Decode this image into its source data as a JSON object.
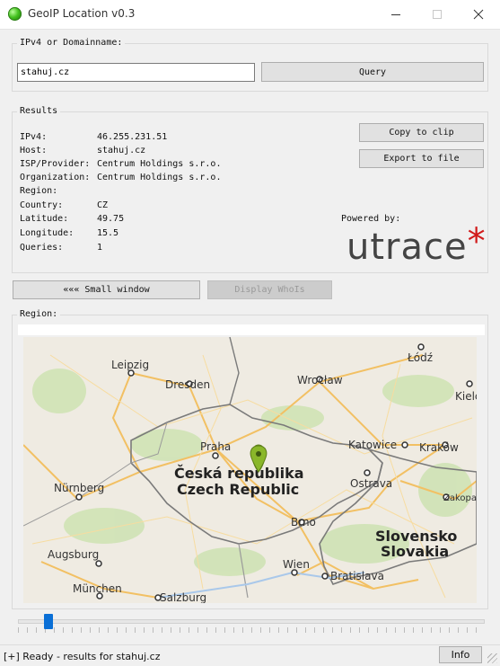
{
  "window": {
    "title": "GeoIP Location v0.3"
  },
  "input_group": {
    "legend": "IPv4 or Domainname:",
    "input_value": "stahuj.cz",
    "query_label": "Query"
  },
  "results": {
    "legend": "Results",
    "rows": [
      {
        "label": "IPv4:",
        "value": "46.255.231.51"
      },
      {
        "label": "Host:",
        "value": "stahuj.cz"
      },
      {
        "label": "ISP/Provider:",
        "value": "Centrum Holdings s.r.o."
      },
      {
        "label": "Organization:",
        "value": "Centrum Holdings s.r.o."
      },
      {
        "label": "Region:",
        "value": ""
      },
      {
        "label": "Country:",
        "value": "CZ"
      },
      {
        "label": "Latitude:",
        "value": "49.75"
      },
      {
        "label": "Longitude:",
        "value": "15.5"
      },
      {
        "label": "Queries:",
        "value": "1"
      }
    ],
    "copy_label": "Copy to clip",
    "export_label": "Export to file",
    "powered_by": "Powered by:",
    "logo_text": "utrace",
    "logo_star": "*"
  },
  "actions": {
    "small_window_label": "««« Small window",
    "whois_label": "Display WhoIs"
  },
  "region": {
    "legend": "Region:",
    "cities": {
      "leipzig": "Leipzig",
      "dresden": "Dresden",
      "wroclaw": "Wrocław",
      "lodz": "Łódź",
      "kielce": "Kielce",
      "praha": "Praha",
      "katowice": "Katowice",
      "krakow": "Kraków",
      "ostrava": "Ostrava",
      "nurnberg": "Nürnberg",
      "zakopane": "Zakopane",
      "brno": "Brno",
      "augsburg": "Augsburg",
      "wien": "Wien",
      "bratislava": "Bratislava",
      "munchen": "München",
      "salzburg": "Salzburg"
    },
    "countries": {
      "cz_local": "Česká republika",
      "cz_en": "Czech Republic",
      "sk_local": "Slovensko",
      "sk_en": "Slovakia"
    },
    "colors": {
      "map_bg": "#efebe2",
      "roads": "#f2c063",
      "forest": "#cfe3b5",
      "border": "#7a7a7a",
      "marker": "#8ab72a"
    }
  },
  "slider": {
    "value_percent": 12
  },
  "status": {
    "text": "[+] Ready - results for stahuj.cz",
    "info_label": "Info"
  }
}
